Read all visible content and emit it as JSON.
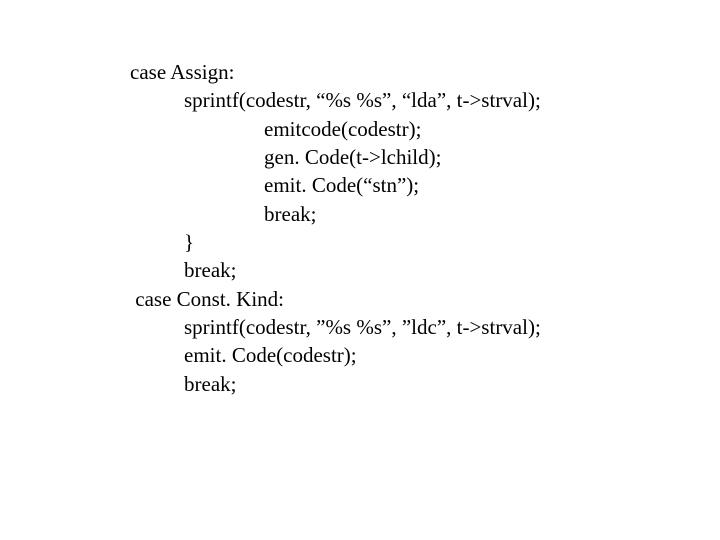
{
  "code": {
    "l1": "case Assign:",
    "l2": "sprintf(codestr, “%s %s”, “lda”, t->strval);",
    "l3": "emitcode(codestr);",
    "l4": "gen. Code(t->lchild);",
    "l5": "emit. Code(“stn”);",
    "l6": "break;",
    "l7": "}",
    "l8": "break;",
    "l9": " case Const. Kind:",
    "l10": "sprintf(codestr, ”%s %s”, ”ldc”, t->strval);",
    "l11": "emit. Code(codestr);",
    "l12": "break;"
  }
}
